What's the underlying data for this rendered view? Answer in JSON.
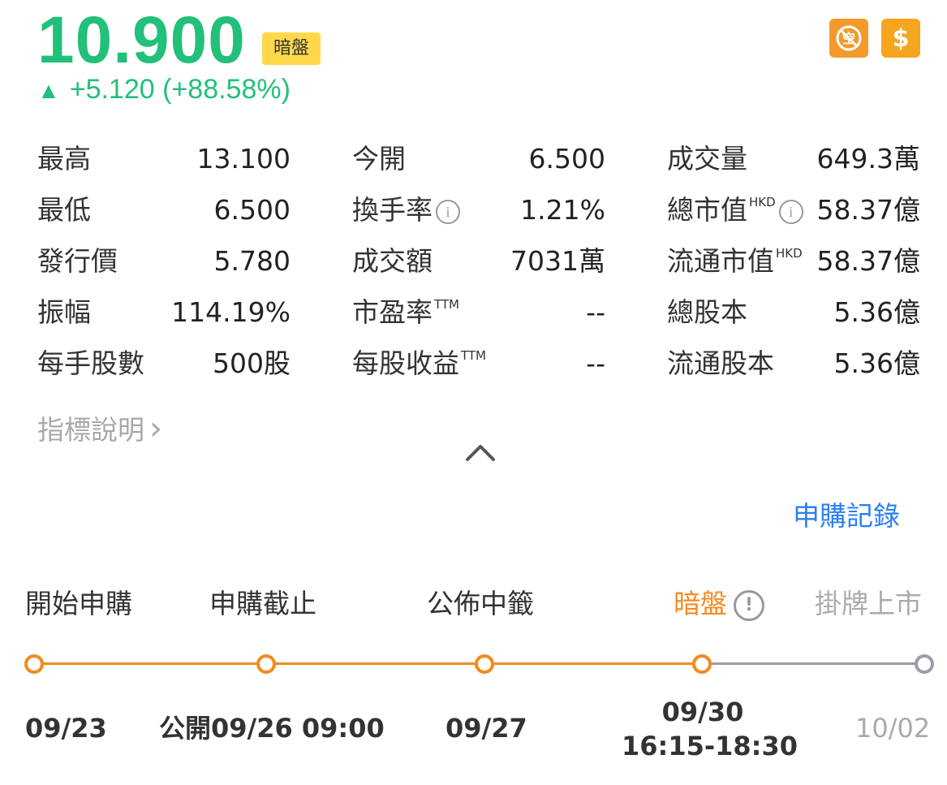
{
  "quote": {
    "price": "10.900",
    "dark_badge": "暗盤",
    "change": "+5.120 (+88.58%)",
    "up_arrow": "▲"
  },
  "header_icons": [
    {
      "name": "no-short-icon",
      "color": "#f39a2c"
    },
    {
      "name": "dollar-icon",
      "glyph": "$",
      "color": "#f5a51e"
    }
  ],
  "stats": {
    "col1": [
      {
        "label": "最高",
        "value": "13.100"
      },
      {
        "label": "最低",
        "value": "6.500"
      },
      {
        "label": "發行價",
        "value": "5.780"
      },
      {
        "label": "振幅",
        "value": "114.19%"
      },
      {
        "label": "每手股數",
        "value": "500股"
      }
    ],
    "col2": [
      {
        "label": "今開",
        "value": "6.500"
      },
      {
        "label": "換手率",
        "value": "1.21%"
      },
      {
        "label": "成交額",
        "value": "7031萬"
      },
      {
        "label": "市盈率",
        "sup": "TTM",
        "value": "--"
      },
      {
        "label": "每股收益",
        "sup": "TTM",
        "value": "--"
      }
    ],
    "col3": [
      {
        "label": "成交量",
        "value": "649.3萬"
      },
      {
        "label": "總市值",
        "sup": "HKD",
        "value": "58.37億"
      },
      {
        "label": "流通市值",
        "sup": "HKD",
        "value": "58.37億"
      },
      {
        "label": "總股本",
        "value": "5.36億"
      },
      {
        "label": "流通股本",
        "value": "5.36億"
      }
    ]
  },
  "info_glyph": "i",
  "indicator_link": "指標說明",
  "indicator_chevron": "›",
  "records_link": "申購記錄",
  "timeline": {
    "steps": [
      {
        "label": "開始申購",
        "date": "09/23"
      },
      {
        "label": "申購截止",
        "date": "公開09/26 09:00"
      },
      {
        "label": "公佈中籤",
        "date": "09/27"
      },
      {
        "label": "暗盤",
        "date_line1": "09/30",
        "date_line2": "16:15-18:30"
      },
      {
        "label": "掛牌上市",
        "date": "10/02"
      }
    ],
    "warn_glyph": "!",
    "active_color": "#f58a1f",
    "inactive_color": "#9a9dab"
  },
  "colors": {
    "up": "#22c07a",
    "link": "#2a7ff0",
    "badge": "#ffd84a"
  }
}
